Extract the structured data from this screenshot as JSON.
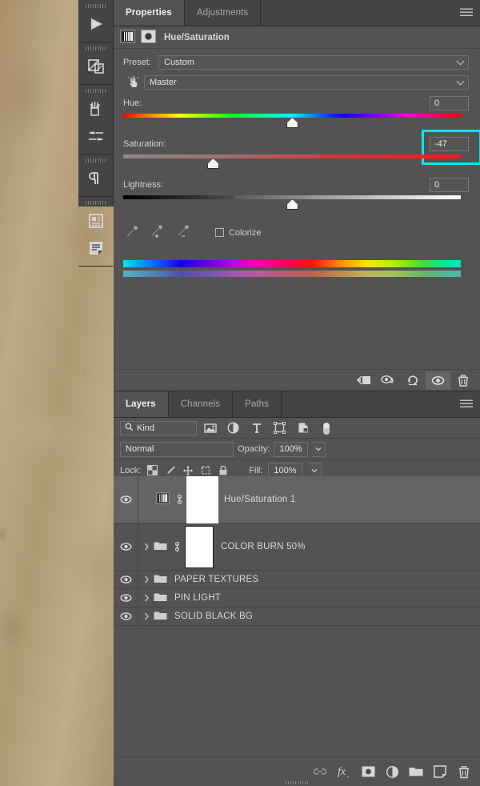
{
  "canvas": {
    "name": "document-canvas"
  },
  "icon_dock": {
    "items": [
      {
        "name": "play-icon",
        "label": "Timeline"
      },
      {
        "name": "layer-comps-icon",
        "label": "Layer Comps"
      },
      {
        "name": "brushes-icon",
        "label": "Brushes"
      },
      {
        "name": "brush-settings-icon",
        "label": "Brush Settings"
      },
      {
        "name": "paragraph-icon",
        "label": "Paragraph"
      },
      {
        "name": "notes-icon",
        "label": "Notes"
      },
      {
        "name": "glyphs-icon",
        "label": "Glyphs"
      }
    ]
  },
  "properties": {
    "tabs": [
      {
        "label": "Properties",
        "active": true
      },
      {
        "label": "Adjustments",
        "active": false
      }
    ],
    "menu_icon": "hamburger-icon",
    "adjustment_title": "Hue/Saturation",
    "adjustment_icon": "hue-saturation-icon",
    "mask_icon": "layer-mask-icon",
    "preset": {
      "label": "Preset:",
      "value": "Custom"
    },
    "channel": {
      "icon": "target-hand-icon",
      "value": "Master"
    },
    "sliders": [
      {
        "label": "Hue:",
        "value": "0",
        "position": 50,
        "highlighted": false
      },
      {
        "label": "Saturation:",
        "value": "-47",
        "position": 26.5,
        "highlighted": true
      },
      {
        "label": "Lightness:",
        "value": "0",
        "position": 50,
        "highlighted": false
      }
    ],
    "highlight_color": "#15e0ec",
    "eyedroppers": [
      {
        "name": "eyedropper-icon",
        "label": "Sample"
      },
      {
        "name": "eyedropper-add-icon",
        "label": "Add to Sample"
      },
      {
        "name": "eyedropper-subtract-icon",
        "label": "Subtract from Sample"
      }
    ],
    "colorize": {
      "label": "Colorize",
      "checked": false
    },
    "footer_buttons": [
      {
        "name": "clip-to-layer-icon",
        "active": false
      },
      {
        "name": "preview-previous-state-icon",
        "active": false
      },
      {
        "name": "reset-icon",
        "active": false
      },
      {
        "name": "toggle-visibility-icon",
        "active": true
      },
      {
        "name": "delete-adjustment-icon",
        "active": false
      }
    ]
  },
  "layers": {
    "tabs": [
      {
        "label": "Layers",
        "active": true
      },
      {
        "label": "Channels",
        "active": false
      },
      {
        "label": "Paths",
        "active": false
      }
    ],
    "menu_icon": "hamburger-icon",
    "filter": {
      "search_icon": "search-icon",
      "kind": "Kind",
      "type_icons": [
        {
          "name": "filter-pixel-icon"
        },
        {
          "name": "filter-adjustment-icon"
        },
        {
          "name": "filter-type-icon"
        },
        {
          "name": "filter-shape-icon"
        },
        {
          "name": "filter-smart-object-icon"
        }
      ],
      "toggle_icon": "filter-toggle-switch"
    },
    "blend": {
      "mode": "Normal",
      "opacity_label": "Opacity:",
      "opacity_value": "100%"
    },
    "lock": {
      "label": "Lock:",
      "icons": [
        {
          "name": "lock-transparent-pixels-icon"
        },
        {
          "name": "lock-image-pixels-icon"
        },
        {
          "name": "lock-position-icon"
        },
        {
          "name": "lock-artboard-nesting-icon"
        },
        {
          "name": "lock-all-icon"
        }
      ],
      "fill_label": "Fill:",
      "fill_value": "100%"
    },
    "rows": [
      {
        "name": "Hue/Saturation 1",
        "type": "adjustment",
        "visible": true,
        "selected": true,
        "expandable": false,
        "linked": true,
        "tall": true
      },
      {
        "name": "COLOR BURN 50%",
        "type": "group",
        "visible": true,
        "selected": false,
        "expandable": true,
        "linked": true,
        "tall": true
      },
      {
        "name": "PAPER TEXTURES",
        "type": "group",
        "visible": true,
        "selected": false,
        "expandable": true,
        "linked": false,
        "tall": false
      },
      {
        "name": "PIN LIGHT",
        "type": "group",
        "visible": true,
        "selected": false,
        "expandable": true,
        "linked": false,
        "tall": false
      },
      {
        "name": "SOLID BLACK BG",
        "type": "group",
        "visible": true,
        "selected": false,
        "expandable": true,
        "linked": false,
        "tall": false
      }
    ],
    "footer_buttons": [
      {
        "name": "link-layers-icon"
      },
      {
        "name": "layer-style-fx-icon"
      },
      {
        "name": "add-layer-mask-icon"
      },
      {
        "name": "new-adjustment-layer-icon"
      },
      {
        "name": "new-group-icon"
      },
      {
        "name": "new-layer-icon"
      },
      {
        "name": "delete-layer-icon"
      }
    ]
  },
  "theme": {
    "panel_bg": "#535353",
    "tabbar_bg": "#444444",
    "border": "#2b2b2b",
    "text": "#d8d8d8"
  }
}
